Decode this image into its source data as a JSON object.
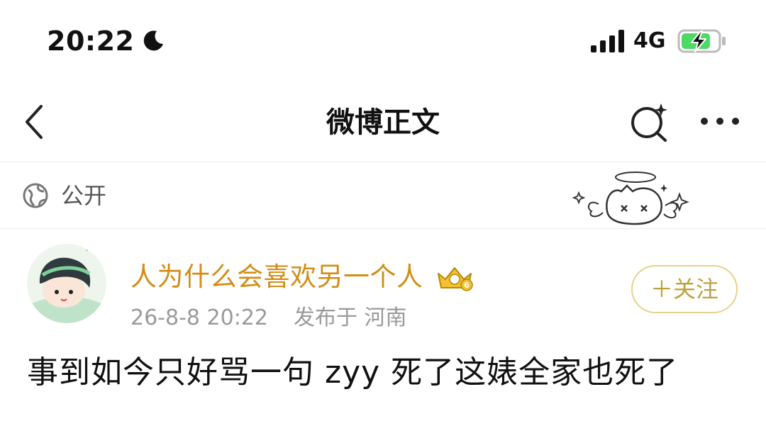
{
  "status_bar": {
    "time": "20:22",
    "network": "4G",
    "icons": [
      "moon-icon",
      "signal-icon",
      "battery-charging-icon"
    ]
  },
  "nav": {
    "title": "微博正文",
    "icons": [
      "back-icon",
      "search-sparkle-icon",
      "more-icon"
    ]
  },
  "visibility": {
    "label": "公开",
    "icon": "globe-icon"
  },
  "post": {
    "username": "人为什么会喜欢另一个人",
    "badge_icon": "crown-badge-icon",
    "badge_level": "6",
    "timestamp": "26-8-8 20:22",
    "location": "发布于 河南",
    "follow_label": "＋关注",
    "content": "事到如今只好骂一句 zyy 死了这婊全家也死了"
  },
  "colors": {
    "username": "#d38d16",
    "follow_text": "#bfa13c",
    "follow_border": "#e6d38a",
    "meta": "#9a9a9a",
    "battery_green": "#4cd964"
  }
}
